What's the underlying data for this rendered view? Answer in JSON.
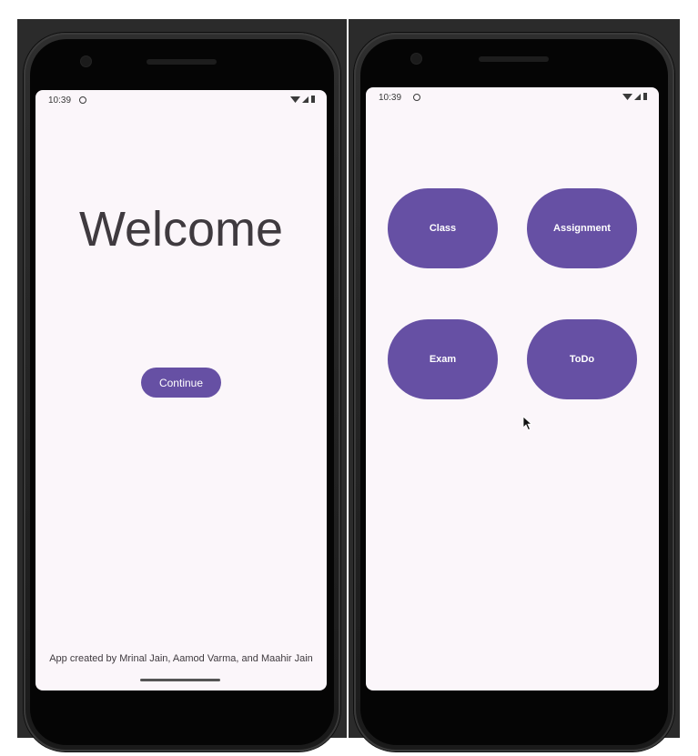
{
  "left_phone": {
    "status": {
      "time": "10:39"
    },
    "title": "Welcome",
    "continue_label": "Continue",
    "credits": "App created by Mrinal Jain, Aamod Varma, and Maahir Jain"
  },
  "right_phone": {
    "status": {
      "time": "10:39"
    },
    "buttons": [
      "Class",
      "Assignment",
      "Exam",
      "ToDo"
    ]
  },
  "colors": {
    "accent": "#6650a4",
    "screen_bg": "#fbf6fa",
    "text": "#3f3a3f",
    "bezel": "#1a1a1a"
  },
  "icons": [
    "wifi-icon",
    "signal-icon",
    "battery-icon",
    "gear-icon",
    "mouse-cursor-icon"
  ]
}
